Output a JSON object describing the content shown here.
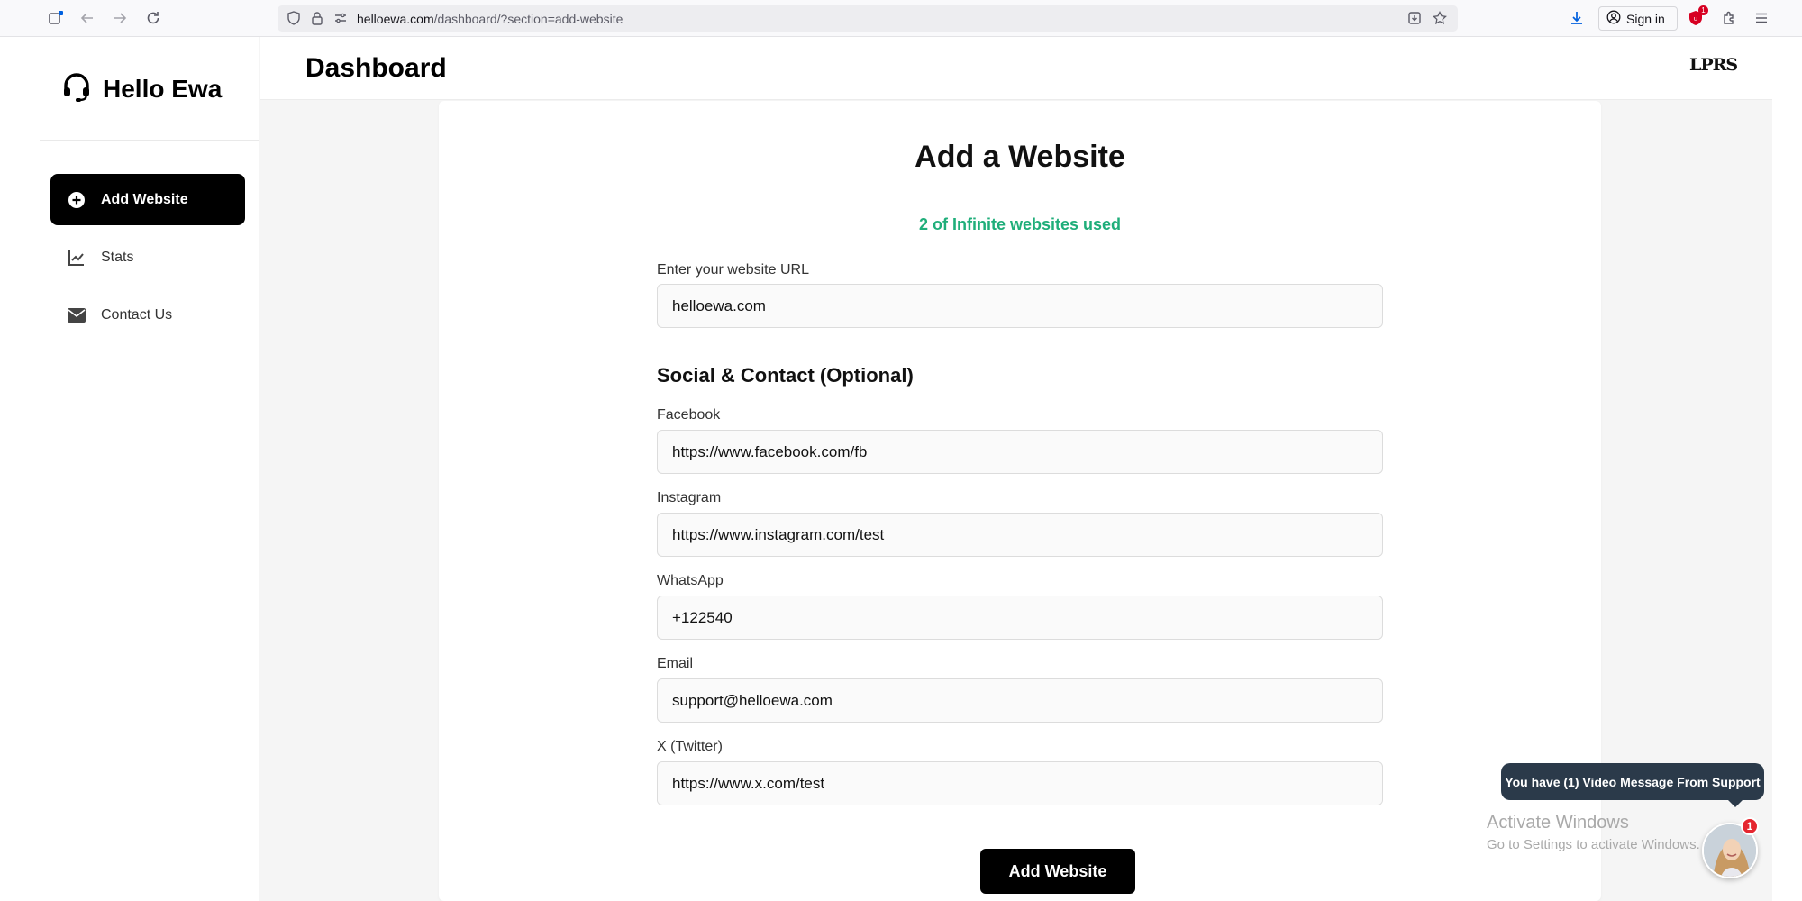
{
  "browser": {
    "url_host": "helloewa.com",
    "url_path": "/dashboard/?section=add-website",
    "signin_label": "Sign in",
    "extension_badge": "1"
  },
  "sidebar": {
    "brand": "Hello Ewa",
    "items": [
      {
        "label": "Add Website",
        "icon": "plus-circle-icon",
        "active": true
      },
      {
        "label": "Stats",
        "icon": "chart-line-icon",
        "active": false
      },
      {
        "label": "Contact Us",
        "icon": "envelope-icon",
        "active": false
      }
    ]
  },
  "header": {
    "title": "Dashboard",
    "logo_text": "LPRS"
  },
  "form": {
    "title": "Add a Website",
    "usage": "2 of Infinite websites used",
    "url_label": "Enter your website URL",
    "url_value": "helloewa.com",
    "social_heading": "Social & Contact (Optional)",
    "facebook_label": "Facebook",
    "facebook_value": "https://www.facebook.com/fb",
    "instagram_label": "Instagram",
    "instagram_value": "https://www.instagram.com/test",
    "whatsapp_label": "WhatsApp",
    "whatsapp_value": "+122540",
    "email_label": "Email",
    "email_value": "support@helloewa.com",
    "twitter_label": "X (Twitter)",
    "twitter_value": "https://www.x.com/test",
    "submit_label": "Add Website"
  },
  "watermark": {
    "title": "Activate Windows",
    "subtitle": "Go to Settings to activate Windows."
  },
  "chat": {
    "message": "You have (1) Video Message From Support",
    "count": "1"
  },
  "colors": {
    "accent": "#000000",
    "usage_text": "#1fae7a",
    "badge": "#e5262f",
    "chat_bubble": "#2b3a4a"
  }
}
